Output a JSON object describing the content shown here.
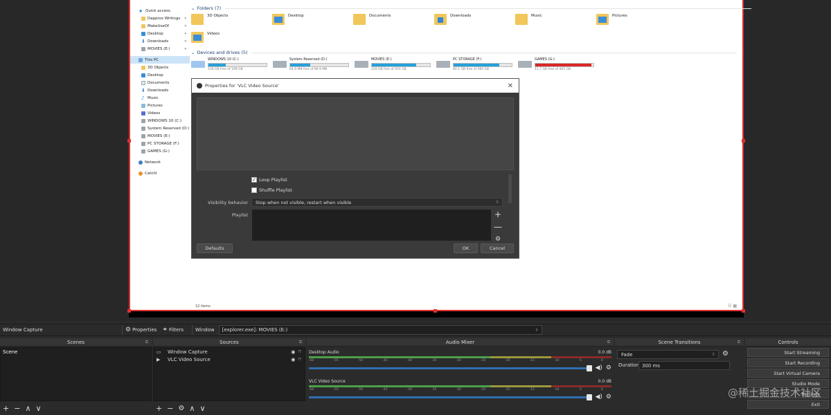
{
  "explorer": {
    "nav": [
      {
        "label": "Quick access",
        "icon": "star",
        "pin": false,
        "sub": false
      },
      {
        "label": "Dappros Writings",
        "icon": "folder",
        "pin": true,
        "sub": true
      },
      {
        "label": "MakeUseOf",
        "icon": "folder",
        "pin": true,
        "sub": true
      },
      {
        "label": "Desktop",
        "icon": "desk",
        "pin": true,
        "sub": true
      },
      {
        "label": "Downloads",
        "icon": "dl",
        "pin": true,
        "sub": true
      },
      {
        "label": "MOVIES (E:)",
        "icon": "drive",
        "pin": true,
        "sub": true
      },
      {
        "label": "This PC",
        "icon": "pc",
        "pin": false,
        "sub": false,
        "sel": true,
        "gap": true
      },
      {
        "label": "3D Objects",
        "icon": "folder",
        "pin": false,
        "sub": true
      },
      {
        "label": "Desktop",
        "icon": "desk",
        "pin": false,
        "sub": true
      },
      {
        "label": "Documents",
        "icon": "doc",
        "pin": false,
        "sub": true
      },
      {
        "label": "Downloads",
        "icon": "dl",
        "pin": false,
        "sub": true
      },
      {
        "label": "Music",
        "icon": "music",
        "pin": false,
        "sub": true
      },
      {
        "label": "Pictures",
        "icon": "pic",
        "pin": false,
        "sub": true
      },
      {
        "label": "Videos",
        "icon": "vid",
        "pin": false,
        "sub": true
      },
      {
        "label": "WINDOWS 10 (C:)",
        "icon": "drive",
        "pin": false,
        "sub": true
      },
      {
        "label": "System Reserved (D:)",
        "icon": "drive",
        "pin": false,
        "sub": true
      },
      {
        "label": "MOVIES (E:)",
        "icon": "drive",
        "pin": false,
        "sub": true
      },
      {
        "label": "PC STORAGE (F:)",
        "icon": "drive",
        "pin": false,
        "sub": true
      },
      {
        "label": "GAMES (G:)",
        "icon": "drive",
        "pin": false,
        "sub": true
      },
      {
        "label": "Network",
        "icon": "net",
        "pin": false,
        "sub": false,
        "gap": true
      },
      {
        "label": "CatchI",
        "icon": "cat",
        "pin": false,
        "sub": false,
        "gap": true
      }
    ],
    "folders_header": "Folders (7)",
    "folders": [
      "3D Objects",
      "Desktop",
      "Documents",
      "Downloads",
      "Music",
      "Pictures",
      "Videos"
    ],
    "drives_header": "Devices and drives (5)",
    "drives": [
      {
        "name": "WINDOWS 10 (C:)",
        "free": "139 GB free of 199 GB",
        "used": 0.3,
        "full": false
      },
      {
        "name": "System Reserved (D:)",
        "free": "64.9 MB free of 99.9 MB",
        "used": 0.35,
        "full": false
      },
      {
        "name": "MOVIES (E:)",
        "free": "220 GB free of 931 GB",
        "used": 0.76,
        "full": false
      },
      {
        "name": "PC STORAGE (F:)",
        "free": "60.1 GB free of 285 GB",
        "used": 0.79,
        "full": false
      },
      {
        "name": "GAMES (G:)",
        "free": "11.7 GB free of 465 GB",
        "used": 0.97,
        "full": true
      }
    ],
    "status": "12 items"
  },
  "dialog": {
    "title": "Properties for 'VLC Video Source'",
    "loop_label": "Loop Playlist",
    "loop_checked": true,
    "shuffle_label": "Shuffle Playlist",
    "shuffle_checked": false,
    "visibility_label": "Visibility behavior",
    "visibility_value": "Stop when not visible, restart when visible",
    "playlist_label": "Playlist",
    "defaults": "Defaults",
    "ok": "OK",
    "cancel": "Cancel"
  },
  "context": {
    "source": "Window Capture",
    "properties": "Properties",
    "filters": "Filters",
    "window_label": "Window",
    "window_value": "[explorer.exe]: MOVIES (E:)"
  },
  "scenes": {
    "title": "Scenes",
    "items": [
      "Scene"
    ]
  },
  "sources": {
    "title": "Sources",
    "items": [
      "Window Capture",
      "VLC Video Source"
    ]
  },
  "mixer": {
    "title": "Audio Mixer",
    "channels": [
      {
        "name": "Desktop Audio",
        "db": "0.0 dB"
      },
      {
        "name": "VLC Video Source",
        "db": "0.0 dB"
      }
    ],
    "ticks": [
      "-60",
      "-55",
      "-50",
      "-45",
      "-40",
      "-35",
      "-30",
      "-25",
      "-20",
      "-15",
      "-10",
      "-5",
      "0"
    ]
  },
  "transitions": {
    "title": "Scene Transitions",
    "value": "Fade",
    "duration_label": "Duration",
    "duration_value": "300 ms"
  },
  "controls": {
    "title": "Controls",
    "buttons": [
      "Start Streaming",
      "Start Recording",
      "Start Virtual Camera",
      "Studio Mode",
      "Settings",
      "Exit"
    ]
  },
  "watermark": "@稀土掘金技术社区"
}
